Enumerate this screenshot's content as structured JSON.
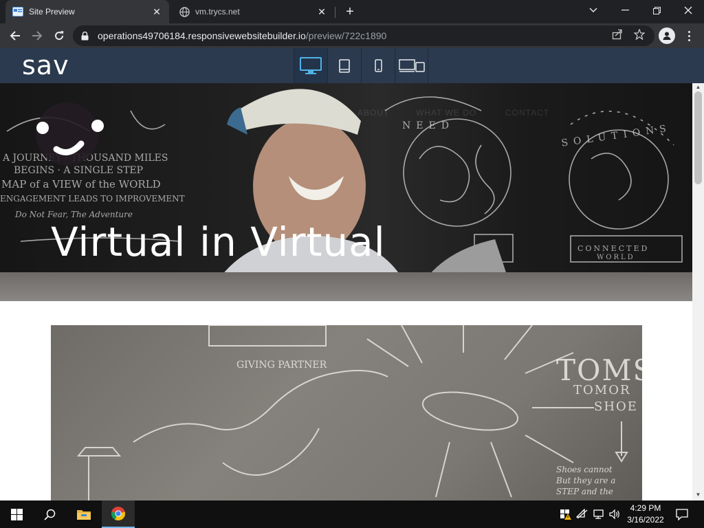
{
  "browser": {
    "tabs": [
      {
        "title": "Site Preview",
        "active": true,
        "favicon": "site-preview-favicon"
      },
      {
        "title": "vm.trycs.net",
        "active": false,
        "favicon": "globe-icon"
      }
    ],
    "url": {
      "host": "operations49706184.responsivewebsitebuilder.io",
      "path": "/preview/722c1890"
    }
  },
  "builder": {
    "brand": "sav",
    "devices": [
      {
        "name": "desktop",
        "active": true
      },
      {
        "name": "tablet",
        "active": false
      },
      {
        "name": "mobile",
        "active": false
      },
      {
        "name": "all-devices",
        "active": false
      }
    ],
    "accent_color": "#2b3a4e",
    "active_icon_color": "#4fb3e8"
  },
  "site": {
    "hero_headline": "Virtual in Virtual",
    "nav_links": [
      "ABOUT",
      "WHAT WE DO",
      "CONTACT"
    ]
  },
  "taskbar": {
    "time": "4:29 PM",
    "date": "3/16/2022",
    "pinned": [
      "start-icon",
      "search-icon",
      "file-explorer-icon",
      "chrome-icon"
    ],
    "tray": [
      "security-alert-icon",
      "network-off-icon",
      "display-icon",
      "volume-icon",
      "notifications-icon"
    ]
  }
}
